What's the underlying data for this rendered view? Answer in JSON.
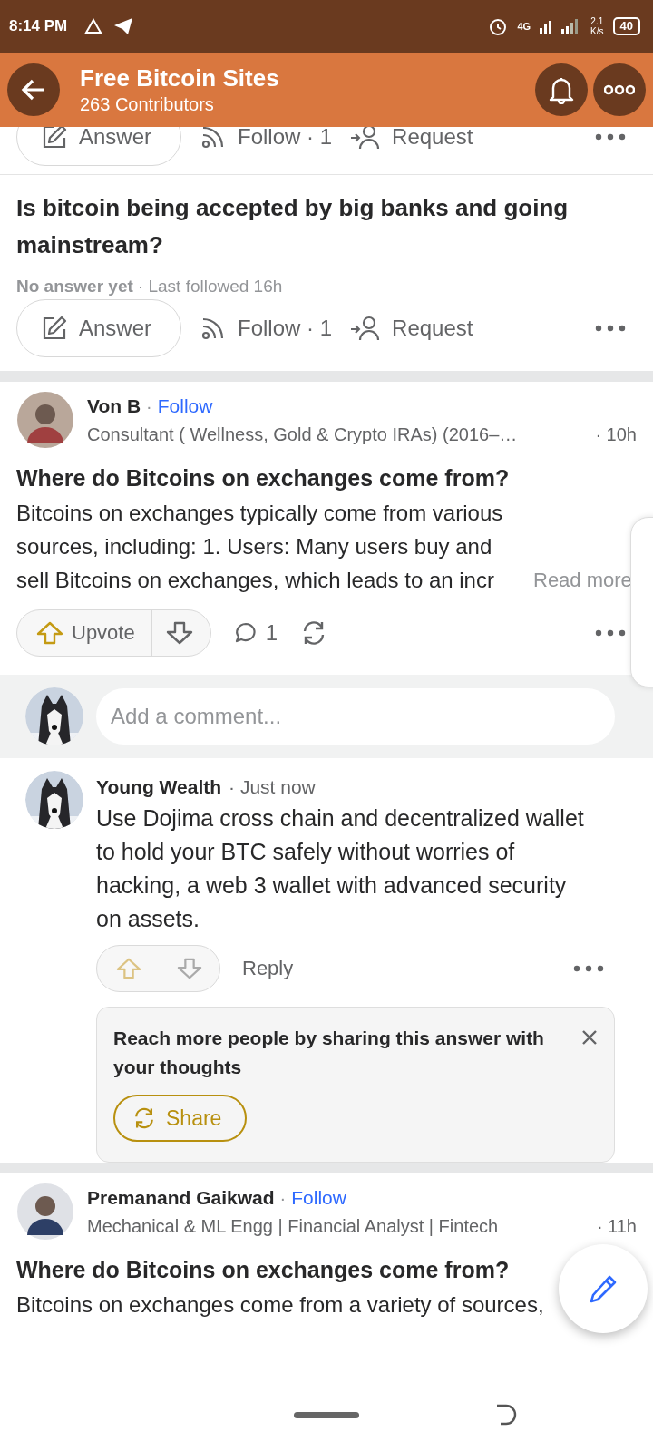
{
  "separator": "·",
  "status_bar": {
    "time": "8:14 PM",
    "network": "4G",
    "speed": "2.1",
    "speed_unit": "K/s",
    "battery": "40"
  },
  "header": {
    "title": "Free Bitcoin Sites",
    "subtitle": "263 Contributors"
  },
  "previous_actions": {
    "answer": "Answer",
    "follow": "Follow",
    "follow_count": "· 1",
    "request": "Request"
  },
  "question": {
    "title": "Is bitcoin being accepted by big banks and going mainstream?",
    "status": "No answer yet",
    "meta": "· Last followed 16h",
    "actions": {
      "answer": "Answer",
      "follow": "Follow",
      "follow_count": "· 1",
      "request": "Request"
    }
  },
  "answers": [
    {
      "author": "Von B",
      "follow": "Follow",
      "credential": "Consultant ( Wellness, Gold & Crypto IRAs) (2016–…",
      "time": "· 10h",
      "title": "Where do Bitcoins on exchanges come from?",
      "body": "Bitcoins on exchanges typically come from various sources, including: 1. Users: Many users buy and sell Bitcoins on exchanges, which leads to an incr",
      "read_more": "Read more",
      "votes": {
        "upvote": "Upvote",
        "comment_count": "1"
      },
      "comment_input": {
        "placeholder": "Add a comment..."
      },
      "comments": [
        {
          "author": "Young Wealth",
          "time": "· Just now",
          "body": "Use Dojima cross chain and decentralized wallet to hold your BTC safely without worries of hacking, a web 3 wallet with advanced security on assets.",
          "reply": "Reply"
        }
      ],
      "share_prompt": {
        "text": "Reach more people by sharing this answer with your thoughts",
        "button": "Share"
      }
    },
    {
      "author": "Premanand Gaikwad",
      "follow": "Follow",
      "credential": "Mechanical & ML Engg | Financial Analyst | Fintech",
      "time": "· 11h",
      "title": "Where do Bitcoins on exchanges come from?",
      "body": "Bitcoins on exchanges come from a variety of sources,"
    }
  ]
}
